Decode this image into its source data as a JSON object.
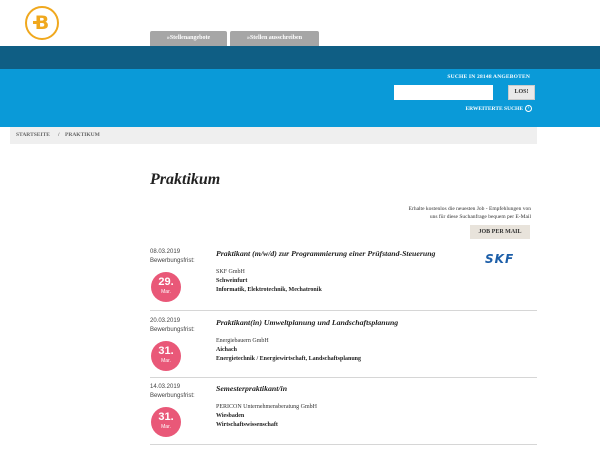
{
  "header": {
    "logo_icon": "circle-b-logo",
    "brand_color": "#f0a81e",
    "tabs": [
      "»Stellenangebote",
      "»Stellen ausschreiben"
    ]
  },
  "search": {
    "title": "SUCHE IN 28148 ANGEBOTEN",
    "placeholder": "",
    "value": "",
    "button_label": "LOS!",
    "advanced_label": "ERWEITERTE SUCHE",
    "advanced_icon": "chevron-circle-icon",
    "colors": {
      "dark_band": "#0f5e84",
      "light_band": "#0a9ad8"
    }
  },
  "breadcrumb": {
    "home": "STARTSEITE",
    "separator": "/",
    "current": "PRAKTIKUM"
  },
  "page": {
    "title": "Praktikum",
    "notice_line1": "Erhalte kostenlos die neuesten Job - Empfehlungen von",
    "notice_line2": "uns für diese Suchanfrage bequem per E-Mail",
    "mail_button": "JOB PER MAIL"
  },
  "jobs": [
    {
      "date": "08.03.2019",
      "deadline_label": "Bewerbungsfrist:",
      "deadline_day": "29.",
      "deadline_month": "Mar.",
      "title": "Praktikant (m/w/d) zur Programmierung einer Prüfstand-Steuerung",
      "company": "SKF GmbH",
      "location": "Schweinfurt",
      "fields": "Informatik, Elektrotechnik, Mechatronik",
      "company_logo": "SKF"
    },
    {
      "date": "20.03.2019",
      "deadline_label": "Bewerbungsfrist:",
      "deadline_day": "31.",
      "deadline_month": "Mar.",
      "title": "Praktikant(in) Umweltplanung und Landschaftsplanung",
      "company": "Energiebauern GmbH",
      "location": "Aichach",
      "fields": "Energietechnik / Energiewirtschaft, Landschaftsplanung"
    },
    {
      "date": "14.03.2019",
      "deadline_label": "Bewerbungsfrist:",
      "deadline_day": "31.",
      "deadline_month": "Mar.",
      "title": "Semesterpraktikant/in",
      "company": "PERICON Unternehmensberatung GmbH",
      "location": "Wiesbaden",
      "fields": "Wirtschaftswissenschaft"
    }
  ],
  "badge_color": "#e95878"
}
